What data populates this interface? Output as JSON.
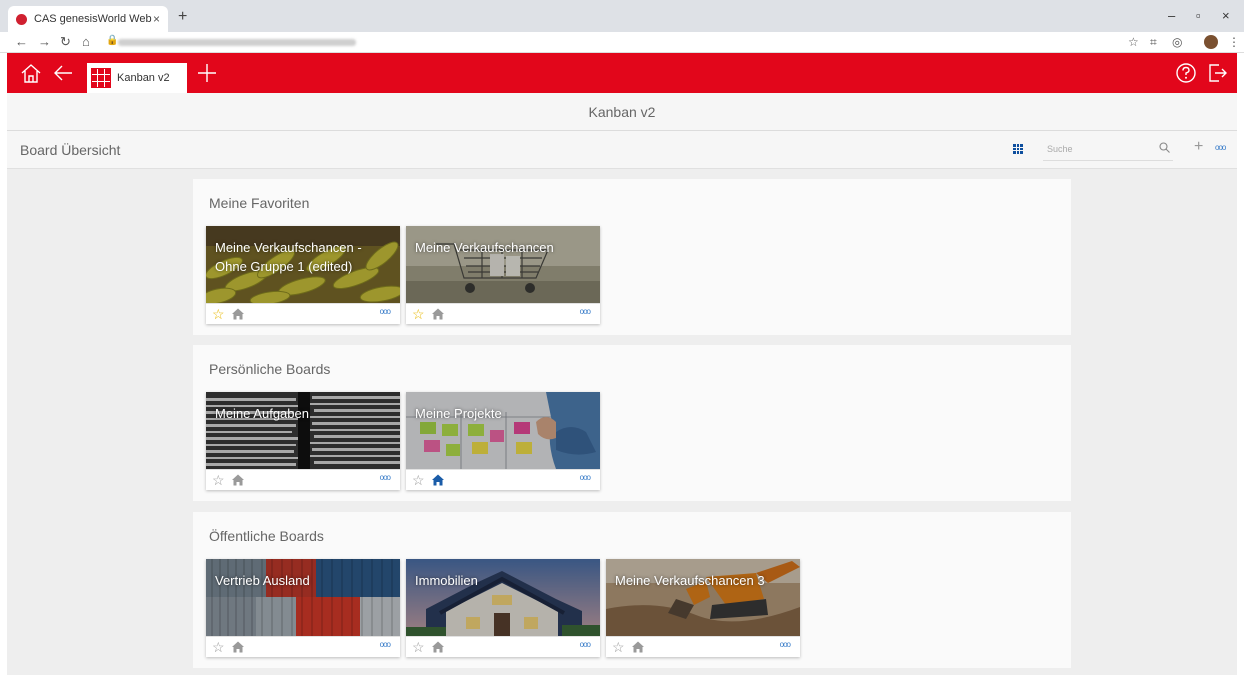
{
  "browser": {
    "tab_title": "CAS genesisWorld Web",
    "tab_close": "×",
    "new_tab": "+",
    "win_minimize": "–",
    "win_restore": "▫",
    "win_close": "×"
  },
  "app": {
    "active_tab": "Kanban v2",
    "add_symbol": "+",
    "page_title": "Kanban v2",
    "toolbar_title": "Board Übersicht",
    "search_placeholder": "Suche"
  },
  "colors": {
    "brand_red": "#e2061b",
    "favorite_star": "#e8b800",
    "home_active": "#1a5ca8",
    "home_inactive": "#9a9a9a",
    "more_blue": "#3a7dc9"
  },
  "sections": [
    {
      "title": "Meine Favoriten",
      "cards": [
        {
          "title": "Meine Verkaufschancen - Ohne Gruppe 1 (edited)",
          "favorite": true,
          "home_active": false,
          "image": "bananas"
        },
        {
          "title": "Meine Verkaufschancen",
          "favorite": true,
          "home_active": false,
          "image": "shopping-cart"
        }
      ]
    },
    {
      "title": "Persönliche Boards",
      "cards": [
        {
          "title": "Meine Aufgaben",
          "favorite": false,
          "home_active": false,
          "image": "paper-stacks"
        },
        {
          "title": "Meine Projekte",
          "favorite": false,
          "home_active": true,
          "image": "kanban-desk"
        }
      ]
    },
    {
      "title": "Öffentliche Boards",
      "cards": [
        {
          "title": "Vertrieb Ausland",
          "favorite": false,
          "home_active": false,
          "image": "shipping-containers"
        },
        {
          "title": "Immobilien",
          "favorite": false,
          "home_active": false,
          "image": "house"
        },
        {
          "title": "Meine Verkaufschancen 3",
          "favorite": false,
          "home_active": false,
          "image": "excavator"
        }
      ]
    }
  ],
  "card_more_symbol": "ooo"
}
